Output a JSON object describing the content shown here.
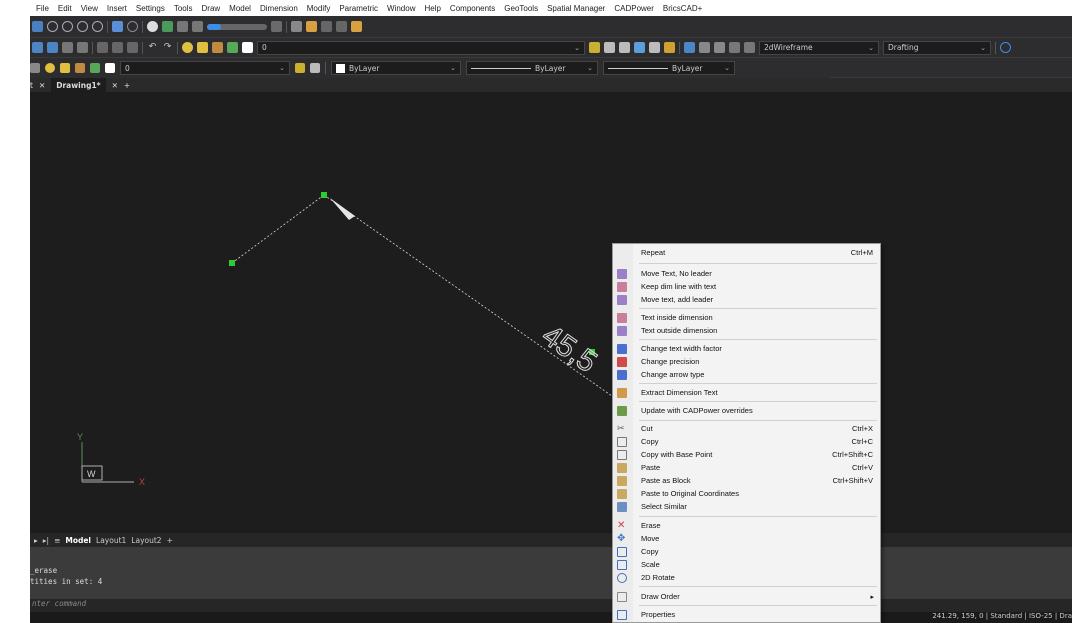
{
  "menubar": [
    "File",
    "Edit",
    "View",
    "Insert",
    "Settings",
    "Tools",
    "Draw",
    "Model",
    "Dimension",
    "Modify",
    "Parametric",
    "Window",
    "Help",
    "Components",
    "GeoTools",
    "Spatial Manager",
    "CADPower",
    "BricsCAD+"
  ],
  "toolbar1": {
    "layer_value": "0",
    "visual_style": "2dWireframe",
    "workspace": "Drafting"
  },
  "toolbar3": {
    "layer_value": "0",
    "color": "ByLayer",
    "linetype": "ByLayer",
    "lineweight": "ByLayer"
  },
  "doc_tabs": {
    "left_fragment": "t",
    "active": "Drawing1*"
  },
  "canvas": {
    "dim_text": "45,5"
  },
  "ucs": {
    "y": "Y",
    "x": "X",
    "w": "W"
  },
  "layout_tabs": [
    "Model",
    "Layout1",
    "Layout2"
  ],
  "command_history": [
    "_erase",
    "tities in set: 4"
  ],
  "command_prompt": "nter command",
  "status": "241.29, 159, 0 | Standard | ISO-25 | Dra",
  "context_menu": {
    "items": [
      {
        "label": "Repeat",
        "shortcut": "Ctrl+M"
      },
      {
        "label": "Move Text, No leader",
        "shortcut": ""
      },
      {
        "label": "Keep dim line with text",
        "shortcut": ""
      },
      {
        "label": "Move text, add leader",
        "shortcut": ""
      },
      {
        "label": "Text inside dimension",
        "shortcut": ""
      },
      {
        "label": "Text outside dimension",
        "shortcut": ""
      },
      {
        "label": "Change text width factor",
        "shortcut": ""
      },
      {
        "label": "Change precision",
        "shortcut": ""
      },
      {
        "label": "Change arrow type",
        "shortcut": ""
      },
      {
        "label": "Extract Dimension Text",
        "shortcut": ""
      },
      {
        "label": "Update with CADPower overrides",
        "shortcut": ""
      },
      {
        "label": "Cut",
        "shortcut": "Ctrl+X"
      },
      {
        "label": "Copy",
        "shortcut": "Ctrl+C"
      },
      {
        "label": "Copy with Base Point",
        "shortcut": "Ctrl+Shift+C"
      },
      {
        "label": "Paste",
        "shortcut": "Ctrl+V"
      },
      {
        "label": "Paste as Block",
        "shortcut": "Ctrl+Shift+V"
      },
      {
        "label": "Paste to Original Coordinates",
        "shortcut": ""
      },
      {
        "label": "Select Similar",
        "shortcut": ""
      },
      {
        "label": "Erase",
        "shortcut": ""
      },
      {
        "label": "Move",
        "shortcut": ""
      },
      {
        "label": "Copy",
        "shortcut": ""
      },
      {
        "label": "Scale",
        "shortcut": ""
      },
      {
        "label": "2D Rotate",
        "shortcut": ""
      },
      {
        "label": "Draw Order",
        "shortcut": ""
      },
      {
        "label": "Properties",
        "shortcut": ""
      }
    ]
  }
}
